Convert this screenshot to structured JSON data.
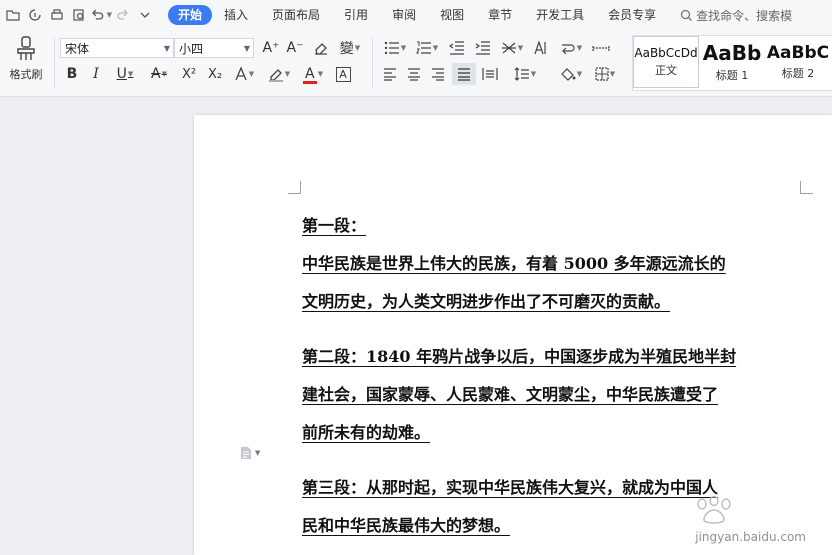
{
  "menubar": {
    "quick_access_icons": [
      "open-icon",
      "save-icon",
      "print-icon",
      "preview-icon",
      "undo-icon",
      "redo-icon",
      "more-icon"
    ],
    "tabs": [
      {
        "label": "开始",
        "active": true
      },
      {
        "label": "插入"
      },
      {
        "label": "页面布局"
      },
      {
        "label": "引用"
      },
      {
        "label": "审阅"
      },
      {
        "label": "视图"
      },
      {
        "label": "章节"
      },
      {
        "label": "开发工具"
      },
      {
        "label": "会员专享"
      }
    ],
    "search_label": "查找命令、搜索模"
  },
  "ribbon": {
    "format_painter_label": "格式刷",
    "font_name": "宋体",
    "font_size": "小四",
    "buttons": {
      "grow_font": "A⁺",
      "shrink_font": "A⁻",
      "bold": "B",
      "italic": "I",
      "underline": "U",
      "strike": "A",
      "superscript": "X²",
      "subscript": "X₂",
      "font_color": "A",
      "char_border": "A",
      "phonetic": "變"
    },
    "styles": [
      {
        "preview": "AaBbCcDd",
        "name": "正文"
      },
      {
        "preview": "AaBb",
        "name": "标题 1"
      },
      {
        "preview": "AaBbC",
        "name": "标题 2"
      }
    ],
    "accent_color": "#3a7cf0",
    "font_color_bar": "#e02020"
  },
  "document": {
    "paragraphs": [
      {
        "lines": [
          "第一段：",
          "中华民族是世界上伟大的民族，有着 5000 多年源远流长的",
          "文明历史，为人类文明进步作出了不可磨灭的贡献。"
        ]
      },
      {
        "lines": [
          "第二段：1840 年鸦片战争以后，中国逐步成为半殖民地半封",
          "建社会，国家蒙辱、人民蒙难、文明蒙尘，中华民族遭受了",
          "前所未有的劫难。"
        ]
      },
      {
        "lines": [
          "第三段：从那时起，实现中华民族伟大复兴，就成为中国人",
          "民和中华民族最伟大的梦想。"
        ]
      }
    ]
  },
  "watermark": "jingyan.baidu.com"
}
